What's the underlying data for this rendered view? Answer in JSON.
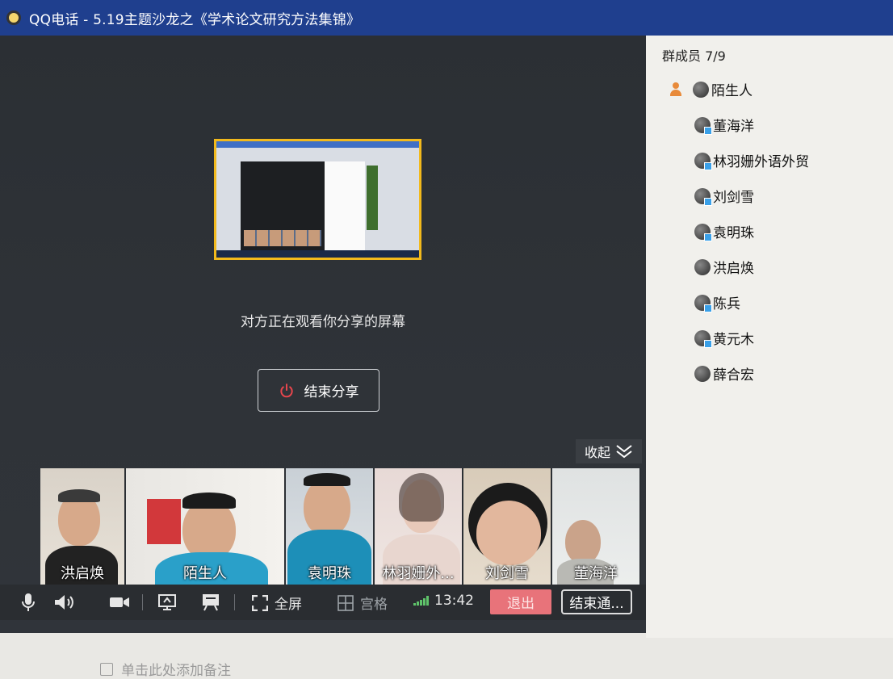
{
  "window": {
    "title": "QQ电话 - 5.19主题沙龙之《学术论文研究方法集锦》"
  },
  "share": {
    "status_text": "对方正在观看你分享的屏幕",
    "end_share_label": "结束分享"
  },
  "video_strip": {
    "collapse_label": "收起",
    "participants": [
      {
        "name": "洪启焕"
      },
      {
        "name": "陌生人"
      },
      {
        "name": "袁明珠"
      },
      {
        "name": "林羽姗外..."
      },
      {
        "name": "刘剑雪"
      },
      {
        "name": "董海洋"
      }
    ]
  },
  "toolbar": {
    "fullscreen_label": "全屏",
    "grid_label": "宫格",
    "time": "13:42",
    "exit_label": "退出",
    "end_call_label": "结束通..."
  },
  "sidebar": {
    "member_count": "群成员 7/9",
    "members": [
      {
        "name": "陌生人",
        "is_self": true
      },
      {
        "name": "董海洋"
      },
      {
        "name": "林羽姗外语外贸"
      },
      {
        "name": "刘剑雪"
      },
      {
        "name": "袁明珠"
      },
      {
        "name": "洪启焕"
      },
      {
        "name": "陈兵"
      },
      {
        "name": "黄元木"
      },
      {
        "name": "薛合宏"
      }
    ]
  },
  "below": {
    "note_text": "单击此处添加备注"
  },
  "colors": {
    "titlebar": "#1f3f8e",
    "exit_button": "#e8737a",
    "preview_border": "#f2b91c",
    "signal": "#5fc36a",
    "power_icon": "#e8464d"
  }
}
